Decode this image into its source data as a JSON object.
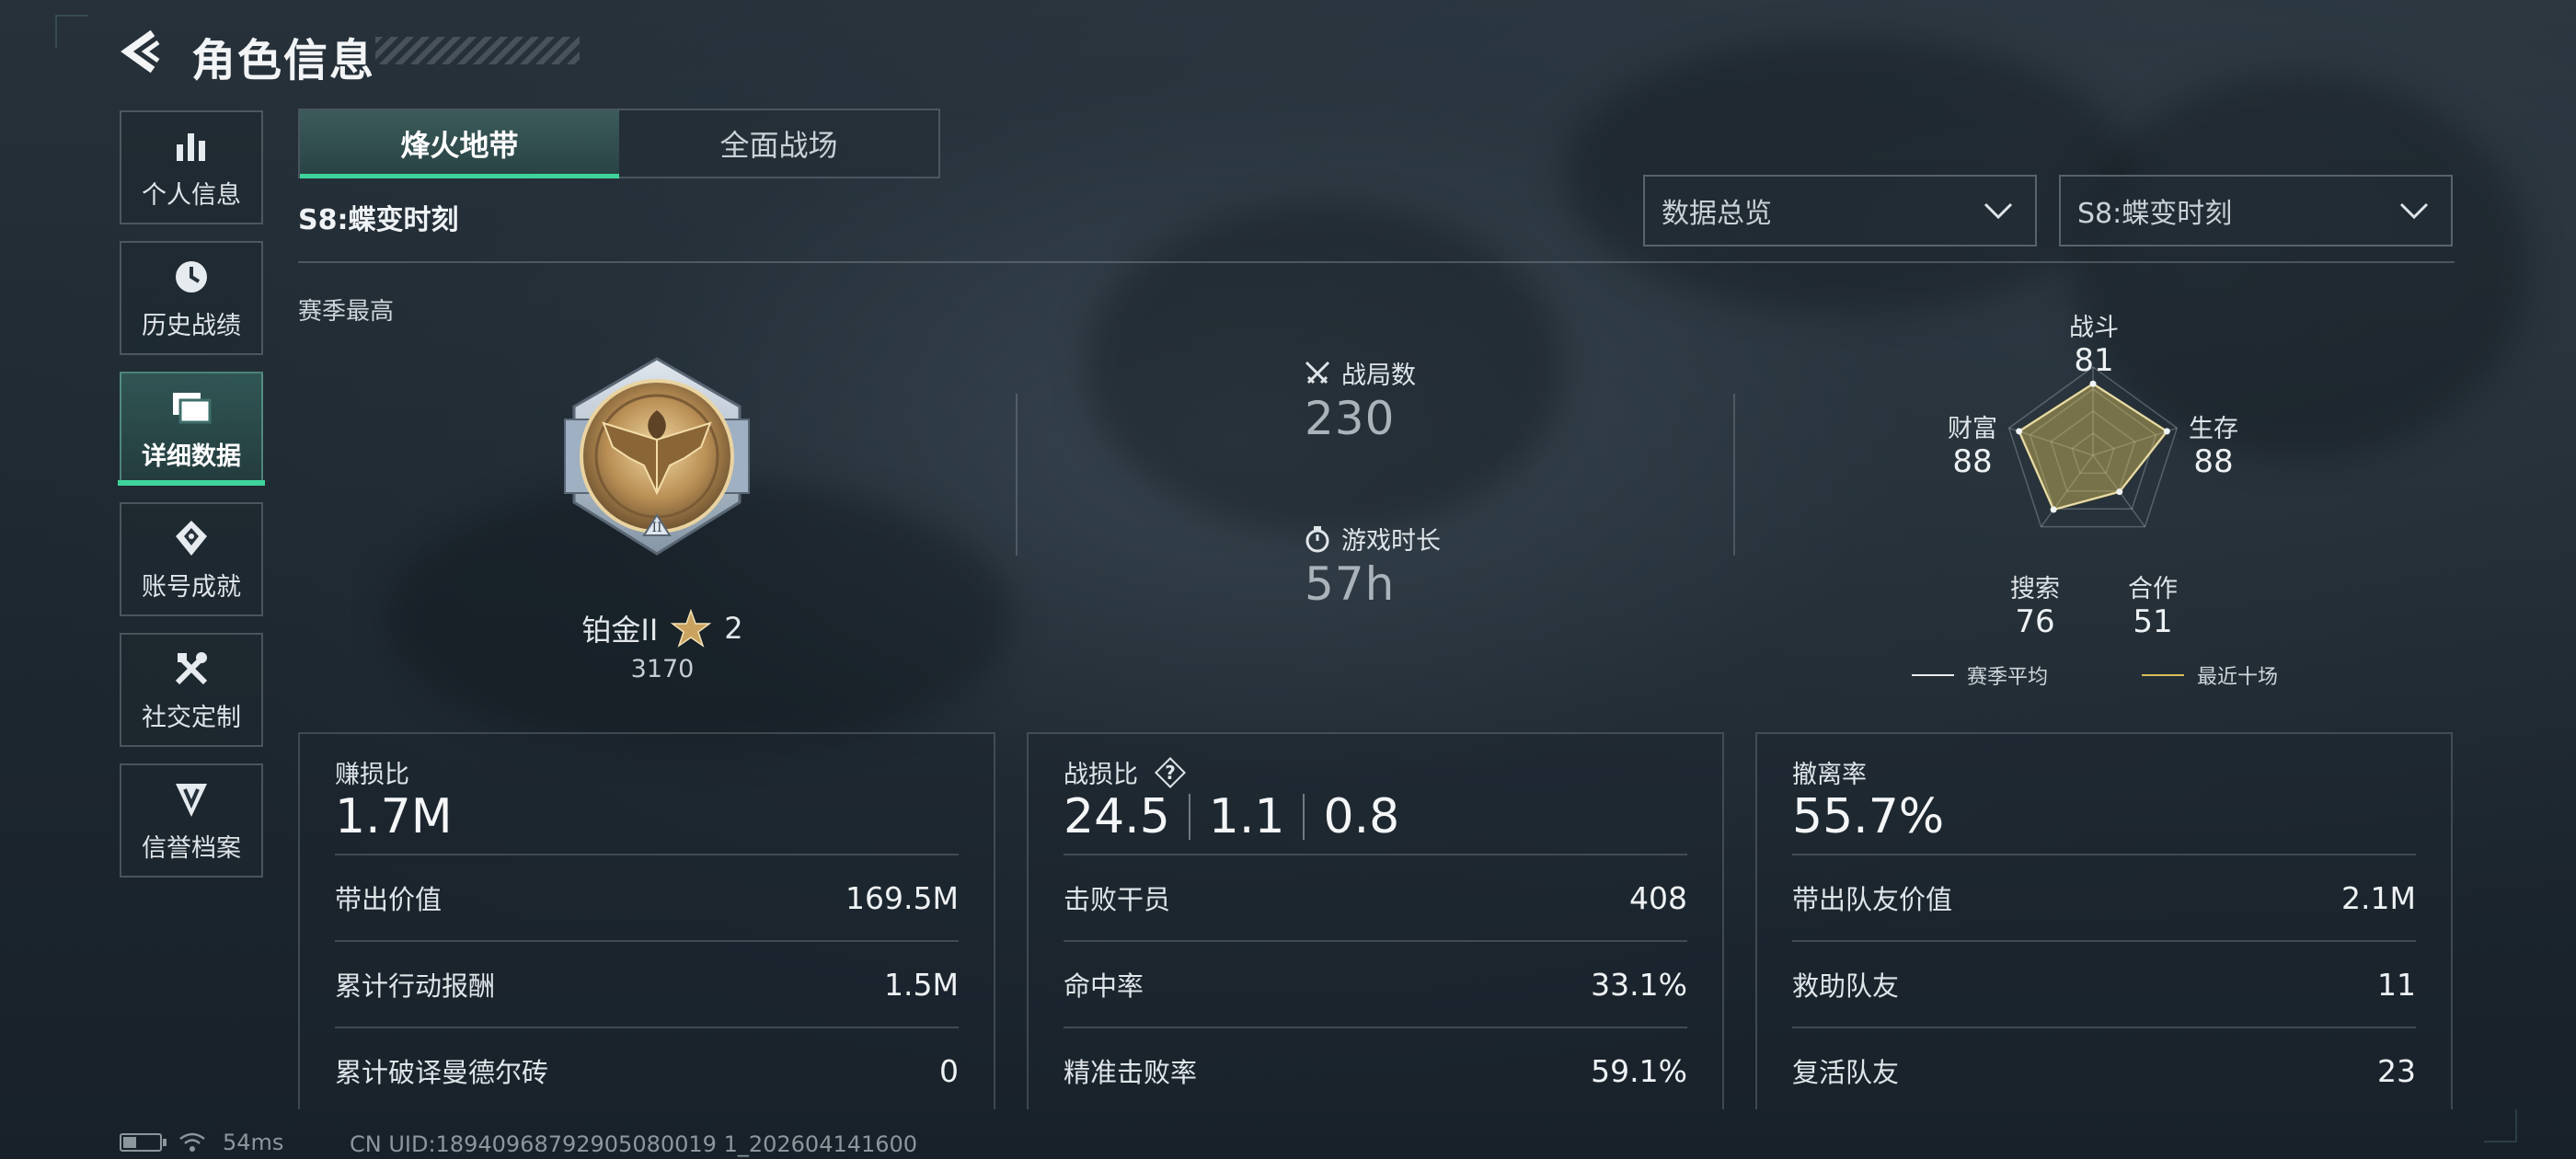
{
  "header": {
    "title": "角色信息"
  },
  "sidebar": {
    "items": [
      {
        "label": "个人信息",
        "icon": "bar-chart-icon"
      },
      {
        "label": "历史战绩",
        "icon": "history-clock-icon"
      },
      {
        "label": "详细数据",
        "icon": "folders-icon",
        "active": true
      },
      {
        "label": "账号成就",
        "icon": "achievement-badge-icon"
      },
      {
        "label": "社交定制",
        "icon": "tools-icon"
      },
      {
        "label": "信誉档案",
        "icon": "shield-emblem-icon"
      }
    ]
  },
  "tabs": [
    {
      "label": "烽火地带",
      "active": true
    },
    {
      "label": "全面战场",
      "active": false
    }
  ],
  "season_title": "S8:蝶变时刻",
  "filters": {
    "view_select": "数据总览",
    "season_select": "S8:蝶变时刻"
  },
  "season_best": {
    "label": "赛季最高",
    "rank_name": "铂金II",
    "stars": "2",
    "points": "3170"
  },
  "summary": {
    "matches_label": "战局数",
    "matches_value": "230",
    "playtime_label": "游戏时长",
    "playtime_value": "57h"
  },
  "radar": {
    "axes": [
      {
        "label": "战斗",
        "value": "81"
      },
      {
        "label": "生存",
        "value": "88"
      },
      {
        "label": "合作",
        "value": "51"
      },
      {
        "label": "搜索",
        "value": "76"
      },
      {
        "label": "财富",
        "value": "88"
      }
    ],
    "legend": [
      {
        "label": "赛季平均",
        "color": "#e8ecef"
      },
      {
        "label": "最近十场",
        "color": "#d9bf5a"
      }
    ]
  },
  "cards": [
    {
      "title": "赚损比",
      "big": "1.7M",
      "rows": [
        {
          "k": "带出价值",
          "v": "169.5M"
        },
        {
          "k": "累计行动报酬",
          "v": "1.5M"
        },
        {
          "k": "累计破译曼德尔砖",
          "v": "0"
        }
      ]
    },
    {
      "title": "战损比",
      "big_parts": [
        "24.5",
        "1.1",
        "0.8"
      ],
      "rows": [
        {
          "k": "击败干员",
          "v": "408"
        },
        {
          "k": "命中率",
          "v": "33.1%"
        },
        {
          "k": "精准击败率",
          "v": "59.1%"
        }
      ]
    },
    {
      "title": "撤离率",
      "big": "55.7%",
      "rows": [
        {
          "k": "带出队友价值",
          "v": "2.1M"
        },
        {
          "k": "救助队友",
          "v": "11"
        },
        {
          "k": "复活队友",
          "v": "23"
        }
      ]
    }
  ],
  "status_bar": {
    "ping": "54ms",
    "uid": "CN UID:18940968792905080019 1_202604141600"
  },
  "colors": {
    "accent": "#3fd39c",
    "radar_recent": "#d9bf5a"
  }
}
